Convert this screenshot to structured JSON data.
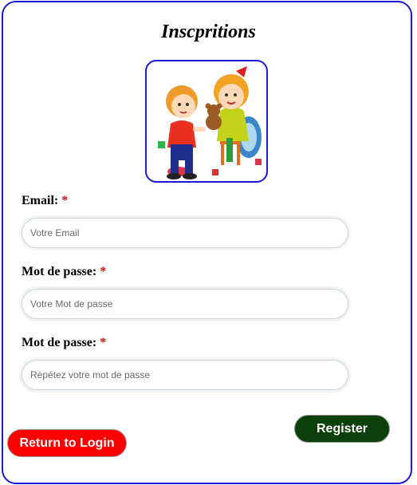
{
  "form": {
    "title": "Inscpritions",
    "image_alt_icon": "children-playing-illustration",
    "fields": [
      {
        "label": "Email:",
        "required_mark": "*",
        "placeholder": "Votre Email",
        "value": ""
      },
      {
        "label": "Mot de passe:",
        "required_mark": "*",
        "placeholder": "Votre Mot de passe",
        "value": ""
      },
      {
        "label": "Mot de passe:",
        "required_mark": "*",
        "placeholder": "Répétez votre mot de passe",
        "value": ""
      }
    ],
    "register_label": "Register",
    "return_label": "Return to Login"
  },
  "colors": {
    "border_accent": "#1a1ad6",
    "register_bg": "#0b400b",
    "return_bg": "#ff0000",
    "required": "#e00000"
  }
}
